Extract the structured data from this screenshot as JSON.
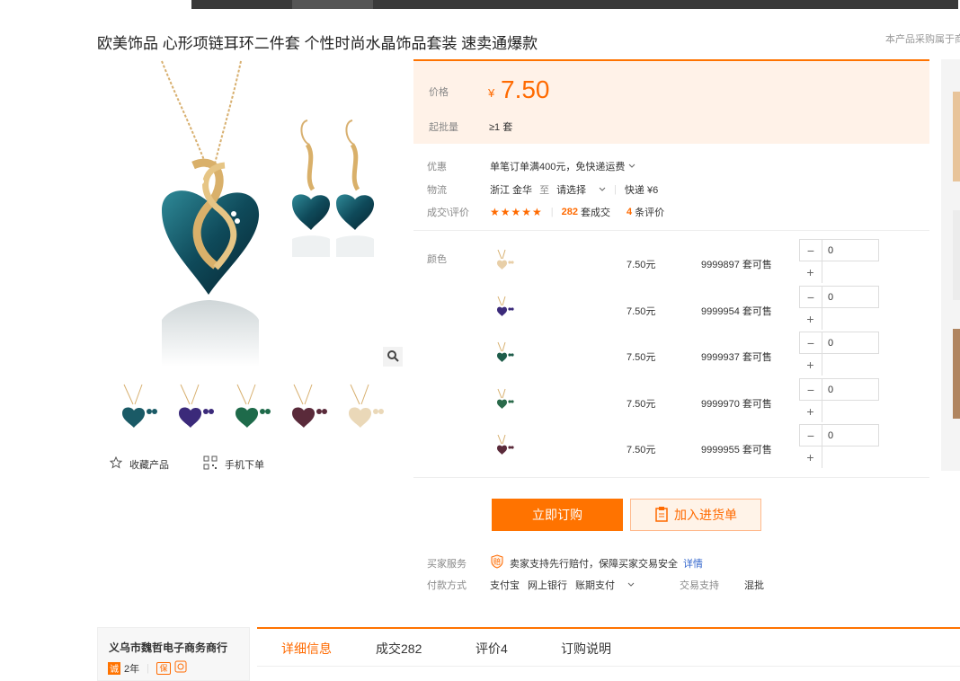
{
  "product": {
    "title": "欧美饰品 心形项链耳环二件套 个性时尚水晶饰品套装 速卖通爆款",
    "side_note": "本产品采购属于商"
  },
  "actions": {
    "favorite_label": "收藏产品",
    "mobile_label": "手机下单"
  },
  "price_panel": {
    "price_label": "价格",
    "currency": "¥",
    "price": "7.50",
    "moq_label": "起批量",
    "moq_value": "≥1 套"
  },
  "info": {
    "promo_label": "优惠",
    "promo_text": "单笔订单满400元，免快递运费",
    "logistics_label": "物流",
    "origin": "浙江 金华",
    "to_text": "至",
    "dest_select": "请选择",
    "shipping": "快递 ¥6",
    "deals_label": "成交\\评价",
    "stars": "★★★★★",
    "deals_count": "282",
    "deals_unit": "套成交",
    "reviews_count": "4",
    "reviews_unit": "条评价"
  },
  "sku": {
    "color_label": "颜色",
    "rows": [
      {
        "price": "7.50元",
        "stock": "9999897 套可售",
        "qty": "0",
        "color": "#e8cfa8"
      },
      {
        "price": "7.50元",
        "stock": "9999954 套可售",
        "qty": "0",
        "color": "#3b2a7a"
      },
      {
        "price": "7.50元",
        "stock": "9999937 套可售",
        "qty": "0",
        "color": "#1e5c4a"
      },
      {
        "price": "7.50元",
        "stock": "9999970 套可售",
        "qty": "0",
        "color": "#2a6a4a"
      },
      {
        "price": "7.50元",
        "stock": "9999955 套可售",
        "qty": "0",
        "color": "#5a2a3a"
      }
    ],
    "minus": "−",
    "plus": "+"
  },
  "buttons": {
    "buy_now": "立即订购",
    "add_to_list": "加入进货单"
  },
  "services": {
    "buyer_label": "买家服务",
    "buyer_text": "卖家支持先行赔付，保障买家交易安全",
    "detail_link": "详情",
    "pay_label": "付款方式",
    "pay_methods": [
      "支付宝",
      "网上银行",
      "账期支付"
    ],
    "trade_label": "交易支持",
    "trade_value": "混批"
  },
  "shop": {
    "name": "义乌市魏哲电子商务商行",
    "cheng": "诚",
    "years": "2年",
    "bao": "保"
  },
  "tabs": [
    "详细信息",
    "成交282",
    "评价4",
    "订购说明"
  ],
  "colors": {
    "accent": "#ff7300",
    "price": "#ff6a00",
    "panel_bg": "#fff2e8"
  }
}
